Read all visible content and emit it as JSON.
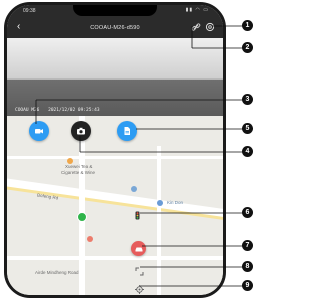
{
  "status_bar": {
    "time": "09:38",
    "icons": "▮▮ ◠ ▭"
  },
  "header": {
    "title": "COOAU-M26-d590"
  },
  "video": {
    "osd_left": "COOAU M26",
    "osd_datetime": "2021/12/02  09:25:43"
  },
  "map": {
    "labels": {
      "shop": "Xuewei Tea &",
      "shop2": "Cigarette & Wine",
      "road": "Bofeng Rd",
      "poi": "Kin Don",
      "bottom": "Airde Mindheng Road"
    }
  },
  "callouts": [
    "1",
    "2",
    "3",
    "4",
    "5",
    "6",
    "7",
    "8",
    "9"
  ],
  "colors": {
    "accent_blue": "#2d9cf3",
    "red": "#e65c5c",
    "dark": "#222222"
  },
  "icons": {
    "settings": "gear-icon",
    "link": "link-icon",
    "record": "video-camera-icon",
    "snapshot": "camera-icon",
    "files": "file-icon",
    "traffic": "traffic-light-icon",
    "vehicle": "car-icon",
    "fullscreen": "expand-icon",
    "locate": "locate-icon"
  }
}
